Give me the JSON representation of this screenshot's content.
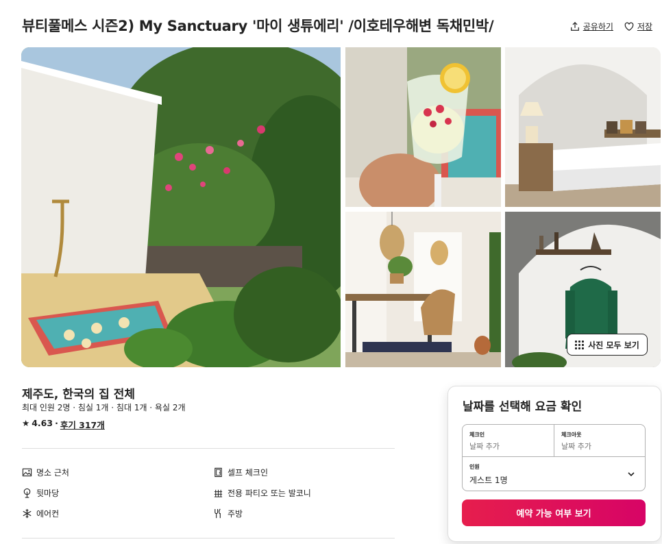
{
  "listing": {
    "title": "뷰티풀메스 시즌2) My Sanctuary '마이 생튜에리' /이호테우해변 독채민박/",
    "share_label": "공유하기",
    "save_label": "저장",
    "show_all_photos_label": "사진 모두 보기",
    "location_title": "제주도, 한국의 집 전체",
    "specs": "최대 인원 2명 · 침실 1개 · 침대 1개 · 욕실 2개",
    "rating": "4.63",
    "reviews_label": "후기 317개"
  },
  "amenities": [
    {
      "label": "명소 근처",
      "icon": "landscape-icon"
    },
    {
      "label": "셀프 체크인",
      "icon": "door-icon"
    },
    {
      "label": "뒷마당",
      "icon": "tree-icon"
    },
    {
      "label": "전용 파티오 또는 발코니",
      "icon": "patio-icon"
    },
    {
      "label": "에어컨",
      "icon": "snowflake-icon"
    },
    {
      "label": "주방",
      "icon": "utensils-icon"
    }
  ],
  "booking": {
    "heading": "날짜를 선택해 요금 확인",
    "checkin_label": "체크인",
    "checkin_placeholder": "날짜 추가",
    "checkout_label": "체크아웃",
    "checkout_placeholder": "날짜 추가",
    "guests_label": "인원",
    "guests_value": "게스트 1명",
    "reserve_button": "예약 가능 여부 보기"
  },
  "colors": {
    "brand": "#e61e4d",
    "text": "#222222",
    "muted": "#717171",
    "border": "#dddddd"
  }
}
